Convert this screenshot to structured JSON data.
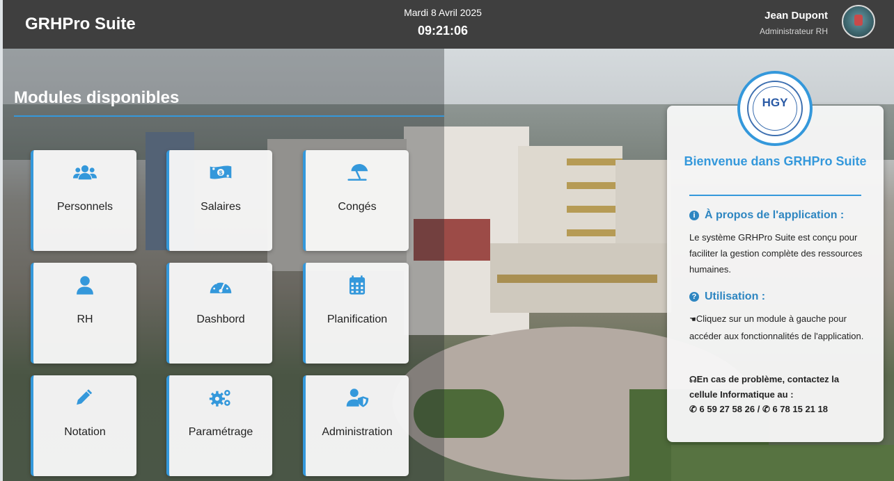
{
  "header": {
    "app_title": "GRHPro Suite",
    "date": "Mardi 8 Avril 2025",
    "time": "09:21:06",
    "user_name": "Jean Dupont",
    "user_role": "Administrateur RH"
  },
  "main": {
    "title": "Modules disponibles",
    "modules": [
      {
        "label": "Personnels",
        "icon": "users-icon"
      },
      {
        "label": "Salaires",
        "icon": "money-bill-icon"
      },
      {
        "label": "Congés",
        "icon": "umbrella-beach-icon"
      },
      {
        "label": "RH",
        "icon": "user-icon"
      },
      {
        "label": "Dashbord",
        "icon": "gauge-icon"
      },
      {
        "label": "Planification",
        "icon": "calendar-icon"
      },
      {
        "label": "Notation",
        "icon": "pencil-icon"
      },
      {
        "label": "Paramétrage",
        "icon": "gears-icon"
      },
      {
        "label": "Administration",
        "icon": "user-shield-icon"
      }
    ]
  },
  "welcome": {
    "logo_text": "HGY",
    "title": "Bienvenue dans GRHPro Suite",
    "about_heading": "À propos de l'application :",
    "about_text": "Le système GRHPro Suite est conçu pour faciliter la gestion complète des ressources humaines.",
    "usage_heading": "Utilisation :",
    "usage_text": "Cliquez sur un module à gauche pour accéder aux fonctionnalités de l'application.",
    "support_text": "En cas de problème, contactez la cellule Informatique au :",
    "phone_1": "6 59 27 58 26",
    "phone_separator": "/",
    "phone_2": "6 78 15 21 18"
  },
  "colors": {
    "accent": "#3498db",
    "header_bg": "#3f3f3f"
  }
}
